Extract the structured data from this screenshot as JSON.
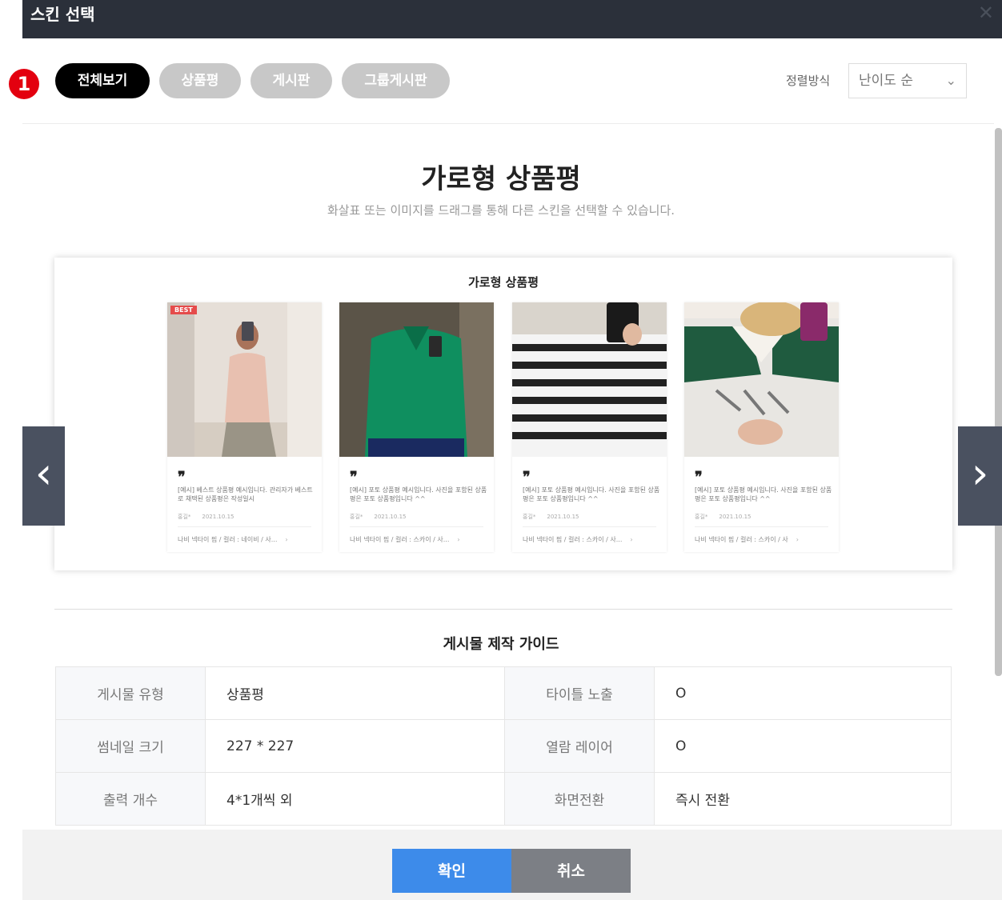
{
  "window": {
    "title": "스킨 선택",
    "close_glyph": "✕"
  },
  "step_badge": "1",
  "tabs": [
    {
      "label": "전체보기",
      "active": true
    },
    {
      "label": "상품평",
      "active": false
    },
    {
      "label": "게시판",
      "active": false
    },
    {
      "label": "그룹게시판",
      "active": false
    }
  ],
  "sort": {
    "label": "정렬방식",
    "selected": "난이도 순"
  },
  "hero": {
    "title": "가로형 상품평",
    "subtitle": "화살표 또는 이미지를 드래그를 통해 다른 스킨을 선택할 수 있습니다."
  },
  "preview": {
    "title": "가로형 상품평",
    "cards": [
      {
        "badge": "BEST",
        "quote": "❞",
        "text": "[예시] 베스트 상품평 예시입니다. 관리자가 베스트로 채택된 상품평은 작성일시",
        "author": "홍길*",
        "date": "2021.10.15",
        "product": "나비 넥타이 핍 / 컬러 : 네이비 / 사...",
        "arrow": "›"
      },
      {
        "badge": "",
        "quote": "❞",
        "text": "[예시] 포토 상품평 예시입니다. 사진을 포함된 상품평은 포토 상품평입니다 ^^",
        "author": "홍길*",
        "date": "2021.10.15",
        "product": "나비 넥타이 핍 / 컬러 : 스카이 / 사...",
        "arrow": "›"
      },
      {
        "badge": "",
        "quote": "❞",
        "text": "[예시] 포토 상품평 예시입니다. 사진을 포함된 상품평은 포토 상품평입니다 ^^",
        "author": "홍길*",
        "date": "2021.10.15",
        "product": "나비 넥타이 핍 / 컬러 : 스카이 / 사...",
        "arrow": "›"
      },
      {
        "badge": "",
        "quote": "❞",
        "text": "[예시] 포토 상품평 예시입니다. 사진을 포함된 상품평은 포토 상품평입니다 ^^",
        "author": "홍길*",
        "date": "2021.10.15",
        "product": "나비 넥타이 핍 / 컬러 : 스카이 / 사",
        "arrow": "›"
      }
    ]
  },
  "nav": {
    "prev": "‹",
    "next": "›"
  },
  "guide": {
    "title": "게시물 제작 가이드",
    "rows": [
      [
        "게시물 유형",
        "상품평",
        "타이틀 노출",
        "O"
      ],
      [
        "썸네일 크기",
        "227 * 227",
        "열람 레이어",
        "O"
      ],
      [
        "출력 개수",
        "4*1개씩 외",
        "화면전환",
        "즉시 전환"
      ]
    ]
  },
  "buttons": {
    "confirm": "확인",
    "cancel": "취소"
  },
  "colors": {
    "primary": "#3d8bea",
    "header": "#2b303a",
    "badge": "#e3000f"
  }
}
